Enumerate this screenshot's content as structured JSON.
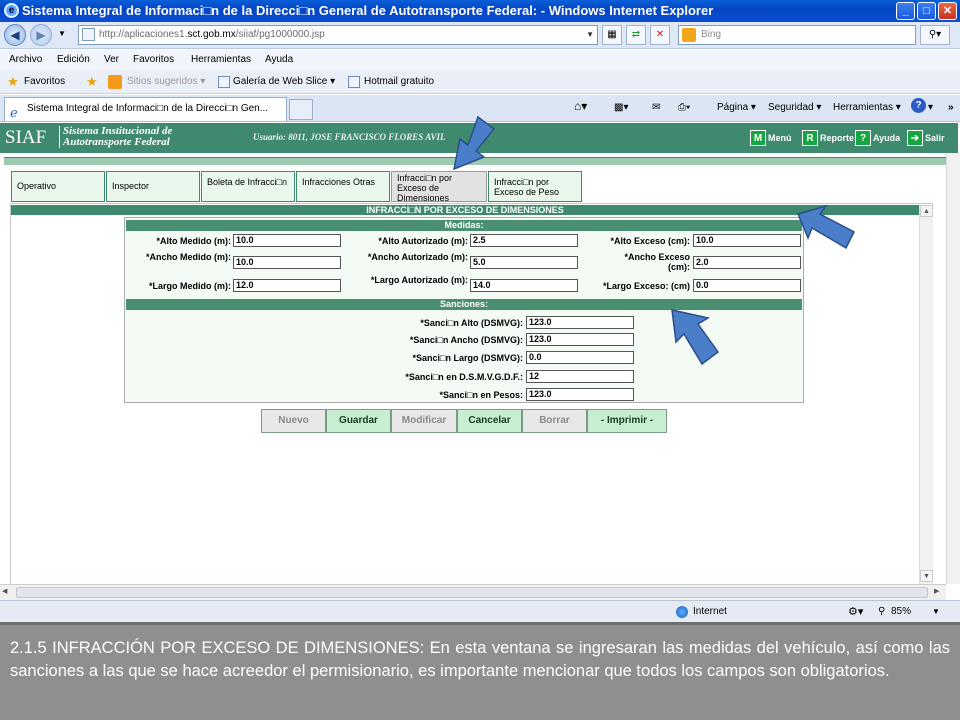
{
  "window": {
    "title": "Sistema Integral de Informaci□n de la Direcci□n General de Autotransporte Federal: - Windows Internet Explorer",
    "icon": "ie-icon",
    "controls": {
      "minimize": "_",
      "maximize": "□",
      "close": "✕"
    }
  },
  "address_bar": {
    "url_prefix": "http://aplicaciones1.",
    "url_domain": "sct.gob.mx",
    "url_path": "/siiaf/pg1000000.jsp",
    "search_placeholder": "Bing"
  },
  "menu": [
    "Archivo",
    "Edición",
    "Ver",
    "Favoritos",
    "Herramientas",
    "Ayuda"
  ],
  "favorites_bar": {
    "favorites": "Favoritos",
    "items": [
      "Sitios sugeridos ▾",
      "Galería de Web Slice ▾",
      "Hotmail gratuito"
    ]
  },
  "browser_tab": {
    "label": "Sistema Integral de Informaci□n de la Direcci□n Gen..."
  },
  "command_bar": [
    "Página ▾",
    "Seguridad ▾",
    "Herramientas ▾"
  ],
  "siaf": {
    "logo": "SIAF",
    "subtitle_line1": "Sistema Institucional de",
    "subtitle_line2": "Autotransporte Federal",
    "user": "Usuario: 8011, JOSE FRANCISCO FLORES AVIL",
    "user_tail": "ulco",
    "actions": [
      {
        "icon": "M",
        "label": "Menú"
      },
      {
        "icon": "R",
        "label": "Reporte"
      },
      {
        "icon": "?",
        "label": "Ayuda"
      },
      {
        "icon": "➔",
        "label": "Salir"
      }
    ]
  },
  "nav_tabs": [
    {
      "label": "Operativo"
    },
    {
      "label": "Inspector"
    },
    {
      "label": "Boleta de Infracci□n"
    },
    {
      "label": "Infracciones Otras"
    },
    {
      "label": "Infracci□n por Exceso de Dimensiones"
    },
    {
      "label": "Infracci□n por Exceso de Peso"
    }
  ],
  "form": {
    "title": "INFRACCI□N POR EXCESO DE DIMENSIONES",
    "medidas": {
      "header": "Medidas:",
      "fields": [
        {
          "label": "*Alto Medido (m):",
          "value": "10.0"
        },
        {
          "label": "*Alto Autorizado (m):",
          "value": "2.5"
        },
        {
          "label": "*Alto Exceso (cm):",
          "value": "10.0"
        },
        {
          "label": "*Ancho Medido (m):",
          "value": "10.0"
        },
        {
          "label": "*Ancho Autorizado (m):",
          "value": "5.0"
        },
        {
          "label": "*Ancho Exceso (cm):",
          "value": "2.0"
        },
        {
          "label": "*Largo Medido (m):",
          "value": "12.0"
        },
        {
          "label": "*Largo Autorizado (m):",
          "value": "14.0"
        },
        {
          "label": "*Largo Exceso: (cm)",
          "value": "0.0"
        }
      ]
    },
    "sanciones": {
      "header": "Sanciones:",
      "fields": [
        {
          "label": "*Sanci□n Alto (DSMVG):",
          "value": "123.0"
        },
        {
          "label": "*Sanci□n Ancho (DSMVG):",
          "value": "123.0"
        },
        {
          "label": "*Sanci□n Largo (DSMVG):",
          "value": "0.0"
        },
        {
          "label": "*Sanci□n en D.S.M.V.G.D.F.:",
          "value": "12"
        },
        {
          "label": "*Sanci□n en Pesos:",
          "value": "123.0"
        }
      ]
    },
    "buttons": [
      {
        "label": "Nuevo",
        "enabled": false
      },
      {
        "label": "Guardar",
        "enabled": true
      },
      {
        "label": "Modificar",
        "enabled": false
      },
      {
        "label": "Cancelar",
        "enabled": true
      },
      {
        "label": "Borrar",
        "enabled": false
      },
      {
        "label": "- Imprimir -",
        "enabled": true
      }
    ]
  },
  "status_bar": {
    "zone": "Internet",
    "zoom": "85%"
  },
  "caption": "2.1.5 INFRACCIÓN POR EXCESO DE DIMENSIONES: En esta ventana se ingresaran las medidas del vehículo, así como las sanciones a las que se hace acreedor el permisionario, es importante mencionar que todos los campos son obligatorios.",
  "colors": {
    "header_green": "#3f8a6e",
    "tab_green": "#e9f7ec",
    "button_green": "#c7eed0",
    "caption_gray": "#8f8f8f",
    "arrow_blue": "#4a7ec8"
  }
}
